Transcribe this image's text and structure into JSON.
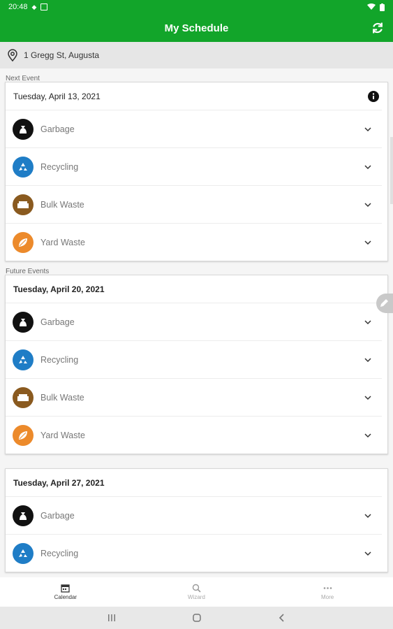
{
  "status_bar": {
    "time": "20:48"
  },
  "app_bar": {
    "title": "My Schedule"
  },
  "location": {
    "address": "1 Gregg St, Augusta"
  },
  "sections": {
    "next_label": "Next Event",
    "future_label": "Future Events"
  },
  "events": [
    {
      "date": "Tuesday, April 13, 2021",
      "items": [
        {
          "label": "Garbage",
          "icon": "garbage-bag-icon",
          "color": "#111111"
        },
        {
          "label": "Recycling",
          "icon": "recycling-icon",
          "color": "#1f7dc6"
        },
        {
          "label": "Bulk Waste",
          "icon": "couch-icon",
          "color": "#8a5a1f"
        },
        {
          "label": "Yard Waste",
          "icon": "leaf-icon",
          "color": "#ec8a2b"
        }
      ]
    },
    {
      "date": "Tuesday, April 20, 2021",
      "items": [
        {
          "label": "Garbage",
          "icon": "garbage-bag-icon",
          "color": "#111111"
        },
        {
          "label": "Recycling",
          "icon": "recycling-icon",
          "color": "#1f7dc6"
        },
        {
          "label": "Bulk Waste",
          "icon": "couch-icon",
          "color": "#8a5a1f"
        },
        {
          "label": "Yard Waste",
          "icon": "leaf-icon",
          "color": "#ec8a2b"
        }
      ]
    },
    {
      "date": "Tuesday, April 27, 2021",
      "items": [
        {
          "label": "Garbage",
          "icon": "garbage-bag-icon",
          "color": "#111111"
        },
        {
          "label": "Recycling",
          "icon": "recycling-icon",
          "color": "#1f7dc6"
        }
      ]
    }
  ],
  "bottom_nav": [
    {
      "label": "Calendar",
      "icon": "calendar-icon",
      "active": true
    },
    {
      "label": "Wizard",
      "icon": "search-icon",
      "active": false
    },
    {
      "label": "More",
      "icon": "more-icon",
      "active": false
    }
  ],
  "colors": {
    "accent": "#12a52a"
  }
}
